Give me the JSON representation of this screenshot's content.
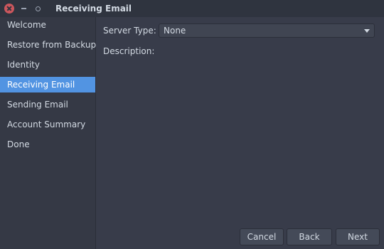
{
  "window": {
    "title": "Receiving Email"
  },
  "sidebar": {
    "items": [
      {
        "label": "Welcome"
      },
      {
        "label": "Restore from Backup"
      },
      {
        "label": "Identity"
      },
      {
        "label": "Receiving Email"
      },
      {
        "label": "Sending Email"
      },
      {
        "label": "Account Summary"
      },
      {
        "label": "Done"
      }
    ],
    "active_index": 3
  },
  "main": {
    "server_type_label": "Server Type:",
    "server_type_value": "None",
    "description_label": "Description:"
  },
  "buttons": {
    "cancel": "Cancel",
    "back": "Back",
    "next": "Next"
  },
  "colors": {
    "accent": "#5294e2",
    "close": "#cc575d"
  }
}
